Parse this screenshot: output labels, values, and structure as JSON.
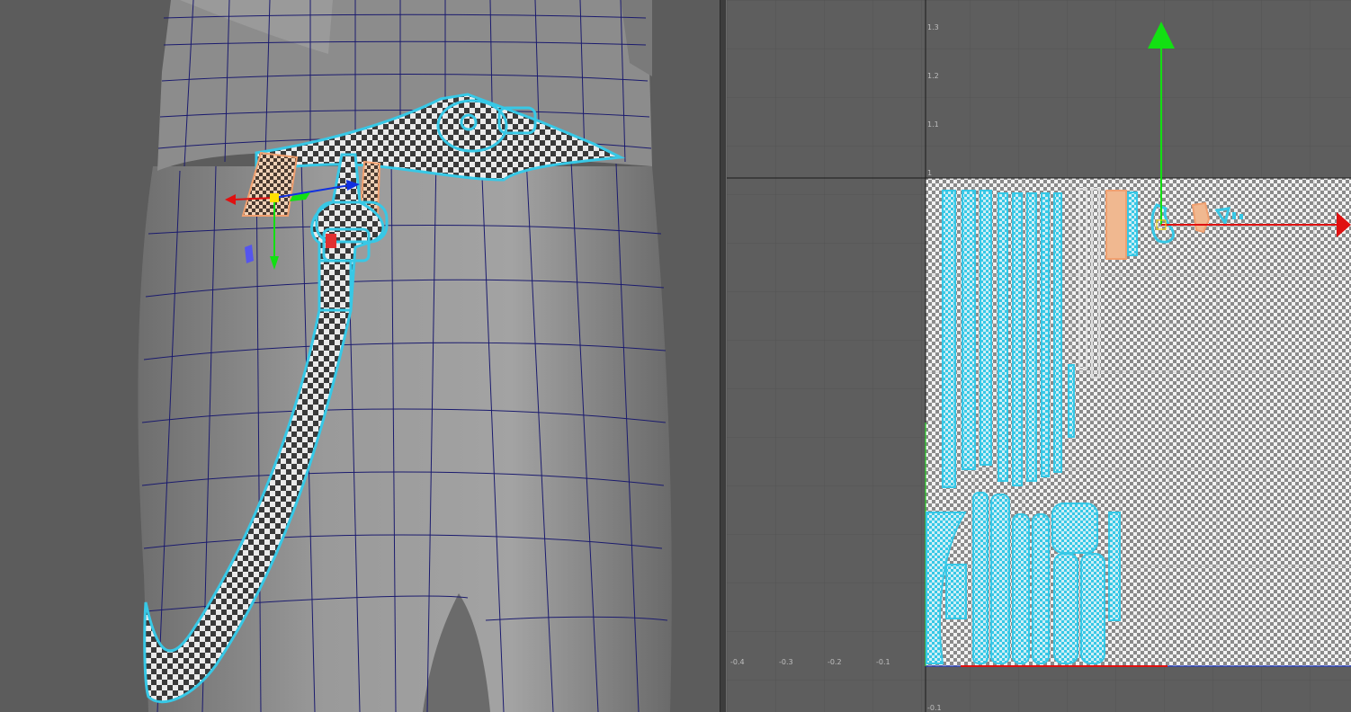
{
  "app": {
    "name": "",
    "panels": [
      "3D viewport",
      "UV editor"
    ]
  },
  "uv_editor": {
    "v_ticks": [
      "1.3",
      "1.2",
      "1.1",
      "1",
      "-0.1"
    ],
    "u_ticks": [
      "-0.4",
      "-0.3",
      "-0.2",
      "-0.1"
    ]
  },
  "icons": {
    "move_manipulator_3d": "move-manipulator-icon",
    "move_manipulator_uv": "uv-move-manipulator-icon"
  },
  "colors": {
    "selection_cyan": "#37c8e6",
    "selected_shell_orange": "#f0a070",
    "wireframe_blue": "#1b1b6e",
    "axis_x": "#e01010",
    "axis_y": "#12e012",
    "axis_z": "#1030e0"
  }
}
